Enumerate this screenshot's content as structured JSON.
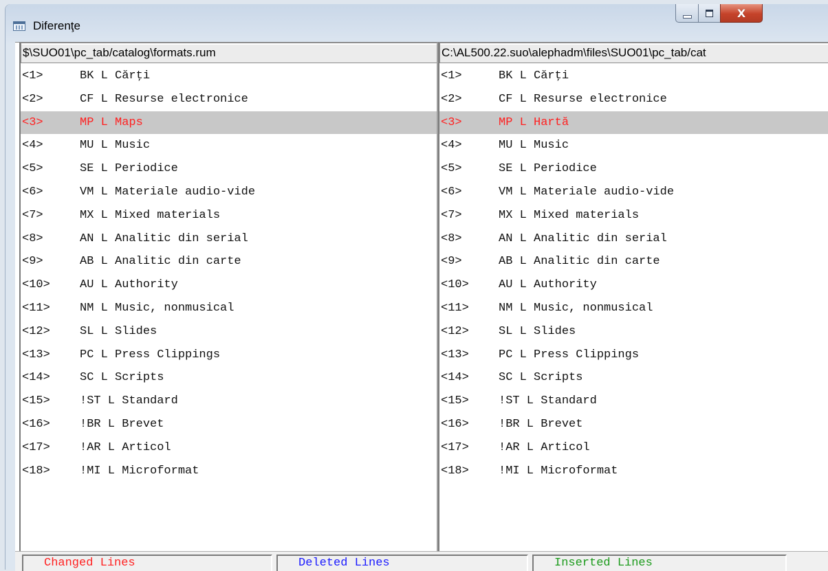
{
  "window": {
    "title": "Diferenţe"
  },
  "left_pane": {
    "path": "$\\SUO01\\pc_tab/catalog\\formats.rum",
    "lines": [
      {
        "num": "<1>",
        "text": "BK L Cărţi",
        "changed": false
      },
      {
        "num": "<2>",
        "text": "CF L Resurse electronice",
        "changed": false
      },
      {
        "num": "<3>",
        "text": "MP L Maps",
        "changed": true
      },
      {
        "num": "<4>",
        "text": "MU L Music",
        "changed": false
      },
      {
        "num": "<5>",
        "text": "SE L Periodice",
        "changed": false
      },
      {
        "num": "<6>",
        "text": "VM L Materiale audio-vide",
        "changed": false
      },
      {
        "num": "<7>",
        "text": "MX L Mixed materials",
        "changed": false
      },
      {
        "num": "<8>",
        "text": "AN L Analitic din serial",
        "changed": false
      },
      {
        "num": "<9>",
        "text": "AB L Analitic din carte",
        "changed": false
      },
      {
        "num": "<10>",
        "text": "AU L Authority",
        "changed": false
      },
      {
        "num": "<11>",
        "text": "NM L Music, nonmusical",
        "changed": false
      },
      {
        "num": "<12>",
        "text": "SL L Slides",
        "changed": false
      },
      {
        "num": "<13>",
        "text": "PC L Press Clippings",
        "changed": false
      },
      {
        "num": "<14>",
        "text": "SC L Scripts",
        "changed": false
      },
      {
        "num": "<15>",
        "text": "!ST L Standard",
        "changed": false
      },
      {
        "num": "<16>",
        "text": "!BR L Brevet",
        "changed": false
      },
      {
        "num": "<17>",
        "text": "!AR L Articol",
        "changed": false
      },
      {
        "num": "<18>",
        "text": "!MI L Microformat",
        "changed": false
      }
    ]
  },
  "right_pane": {
    "path": "C:\\AL500.22.suo\\alephadm\\files\\SUO01\\pc_tab/cat",
    "lines": [
      {
        "num": "<1>",
        "text": "BK L Cărţi",
        "changed": false
      },
      {
        "num": "<2>",
        "text": "CF L Resurse electronice",
        "changed": false
      },
      {
        "num": "<3>",
        "text": "MP L Hartă",
        "changed": true
      },
      {
        "num": "<4>",
        "text": "MU L Music",
        "changed": false
      },
      {
        "num": "<5>",
        "text": "SE L Periodice",
        "changed": false
      },
      {
        "num": "<6>",
        "text": "VM L Materiale audio-vide",
        "changed": false
      },
      {
        "num": "<7>",
        "text": "MX L Mixed materials",
        "changed": false
      },
      {
        "num": "<8>",
        "text": "AN L Analitic din serial",
        "changed": false
      },
      {
        "num": "<9>",
        "text": "AB L Analitic din carte",
        "changed": false
      },
      {
        "num": "<10>",
        "text": "AU L Authority",
        "changed": false
      },
      {
        "num": "<11>",
        "text": "NM L Music, nonmusical",
        "changed": false
      },
      {
        "num": "<12>",
        "text": "SL L Slides",
        "changed": false
      },
      {
        "num": "<13>",
        "text": "PC L Press Clippings",
        "changed": false
      },
      {
        "num": "<14>",
        "text": "SC L Scripts",
        "changed": false
      },
      {
        "num": "<15>",
        "text": "!ST L Standard",
        "changed": false
      },
      {
        "num": "<16>",
        "text": "!BR L Brevet",
        "changed": false
      },
      {
        "num": "<17>",
        "text": "!AR L Articol",
        "changed": false
      },
      {
        "num": "<18>",
        "text": "!MI L Microformat",
        "changed": false
      }
    ]
  },
  "legend": {
    "changed_label": "Changed Lines",
    "deleted_label": "Deleted Lines",
    "inserted_label": "Inserted Lines"
  },
  "colors": {
    "changed": "#ff2020",
    "deleted": "#1a1aff",
    "inserted": "#1a9a1a",
    "changed_row_background": "#c8c8c8"
  },
  "icons": {
    "app": "table-icon",
    "minimize": "minimize-icon",
    "maximize": "maximize-icon",
    "close": "close-icon"
  }
}
